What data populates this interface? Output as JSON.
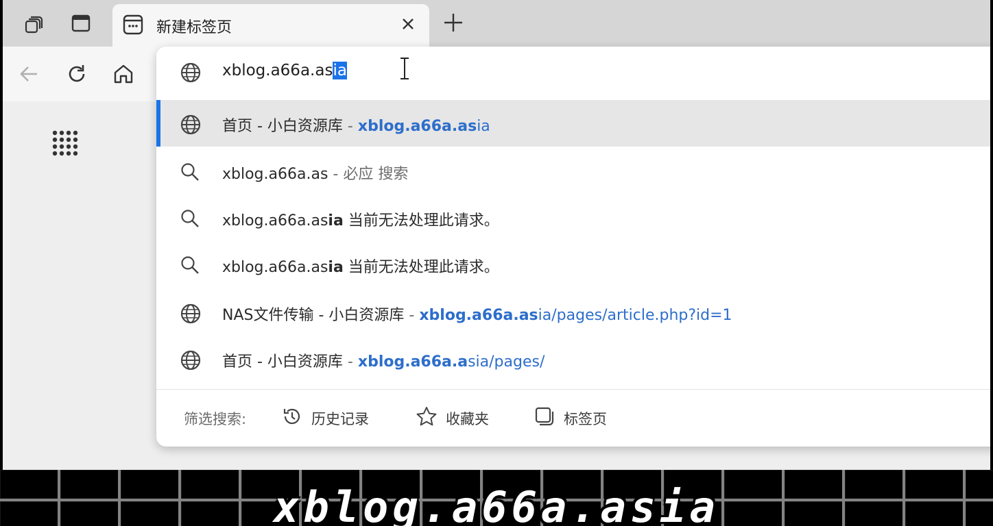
{
  "colors": {
    "accent": "#1a73e8",
    "link": "#2d6ecb",
    "highlight_row": "#e6e6e6"
  },
  "tab": {
    "title": "新建标签页",
    "favicon": "newtab-icon"
  },
  "toolbar": {
    "icons": [
      "workspaces-icon",
      "vertical-tabs-icon",
      "back-icon",
      "refresh-icon",
      "home-icon",
      "apps-grid-icon",
      "new-tab-plus-icon",
      "close-icon"
    ]
  },
  "omnibox": {
    "typed": "xblog.a66a.as",
    "autocomplete": "ia"
  },
  "suggestions": [
    {
      "icon": "globe-icon",
      "title": "首页 - 小白资源库",
      "dash": " - ",
      "url_bold": "xblog.a66a.as",
      "url_rest": "ia",
      "highlighted": true
    },
    {
      "icon": "search-icon",
      "query": "xblog.a66a.as",
      "suffix": " - 必应 搜索"
    },
    {
      "icon": "search-icon",
      "q1": "xblog.a66a.as",
      "q2": "ia",
      "note": " 当前无法处理此请求。"
    },
    {
      "icon": "search-icon",
      "q1": "xblog.a66a.as",
      "q2": "ia",
      "note": " 当前无法处理此请求。"
    },
    {
      "icon": "globe-icon",
      "title": "NAS文件传输 - 小白资源库",
      "dash": " - ",
      "url_bold": "xblog.a66a.as",
      "url_rest": "ia/pages/article.php?id=1"
    },
    {
      "icon": "globe-icon",
      "title": "首页 - 小白资源库",
      "dash": " - ",
      "url_bold": "xblog.a66a.a",
      "url_rest": "sia/pages/"
    }
  ],
  "filter": {
    "label": "筛选搜索:",
    "history": "历史记录",
    "favorites": "收藏夹",
    "tabs": "标签页"
  },
  "caption": "xblog.a66a.asia"
}
